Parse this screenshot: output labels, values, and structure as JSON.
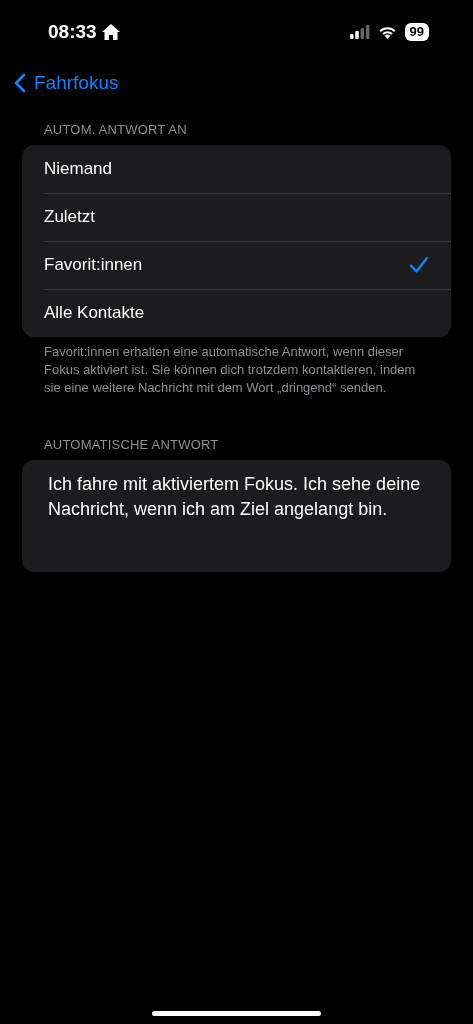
{
  "status_bar": {
    "time": "08:33",
    "battery": "99"
  },
  "nav": {
    "back_label": "Fahrfokus"
  },
  "reply_to": {
    "header": "AUTOM. ANTWORT AN",
    "options": [
      {
        "label": "Niemand",
        "selected": false
      },
      {
        "label": "Zuletzt",
        "selected": false
      },
      {
        "label": "Favorit:innen",
        "selected": true
      },
      {
        "label": "Alle Kontakte",
        "selected": false
      }
    ],
    "footer": "Favorit:innen erhalten eine automatische Antwort, wenn dieser Fokus aktiviert ist. Sie können dich trotzdem kontaktieren, indem sie eine weitere Nachricht mit dem Wort „dringend“ senden."
  },
  "auto_reply": {
    "header": "AUTOMATISCHE ANTWORT",
    "value": "Ich fahre mit aktiviertem Fokus. Ich sehe deine Nachricht, wenn ich am Ziel angelangt bin."
  }
}
